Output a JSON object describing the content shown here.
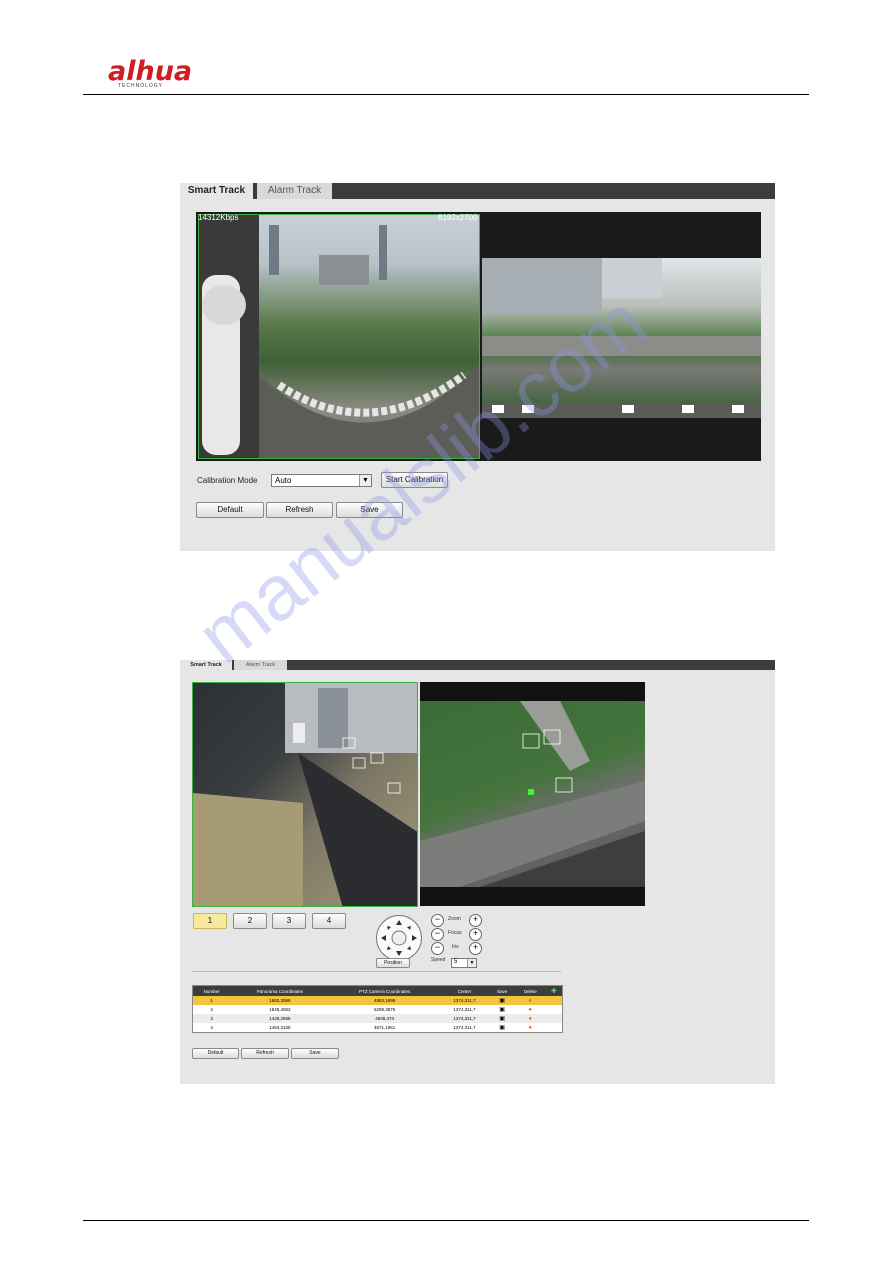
{
  "header": {
    "logo_text": "alhua",
    "logo_sub": "TECHNOLOGY"
  },
  "watermark": "manualslib.com",
  "panel1": {
    "tabs": [
      {
        "label": "Smart Track"
      },
      {
        "label": "Alarm Track"
      }
    ],
    "bitrate": "14312Kbps",
    "resolution": "8192x2700",
    "calibration_label": "Calibration Mode",
    "calibration_value": "Auto",
    "start_calibration": "Start Calibration",
    "buttons": {
      "default": "Default",
      "refresh": "Refresh",
      "save": "Save"
    }
  },
  "panel2": {
    "tabs": [
      {
        "label": "Smart Track"
      },
      {
        "label": "Alarm Track"
      }
    ],
    "scenes": [
      "1",
      "2",
      "3",
      "4"
    ],
    "ptz": {
      "position": "Position",
      "zoom": "Zoom",
      "focus": "Focus",
      "iris": "Iris",
      "speed_label": "Speed",
      "speed_value": "5"
    },
    "table": {
      "headers": [
        "Number",
        "Panorama Coordinates",
        "PTZ Camera Coordinates",
        "Center",
        "Save",
        "Delete"
      ],
      "rows": [
        {
          "number": "1",
          "panorama": "1683,3068",
          "ptz": "4953,1895",
          "center": "1374,311,7"
        },
        {
          "number": "2",
          "panorama": "1845,4062",
          "ptz": "5299,3875",
          "center": "1374,311,7"
        },
        {
          "number": "3",
          "panorama": "1429,2558",
          "ptz": "4938,473",
          "center": "1374,311,7"
        },
        {
          "number": "4",
          "panorama": "1453,3158",
          "ptz": "4671,1951",
          "center": "1374,311,7"
        }
      ]
    },
    "buttons": {
      "default": "Default",
      "refresh": "Refresh",
      "save": "Save"
    }
  }
}
